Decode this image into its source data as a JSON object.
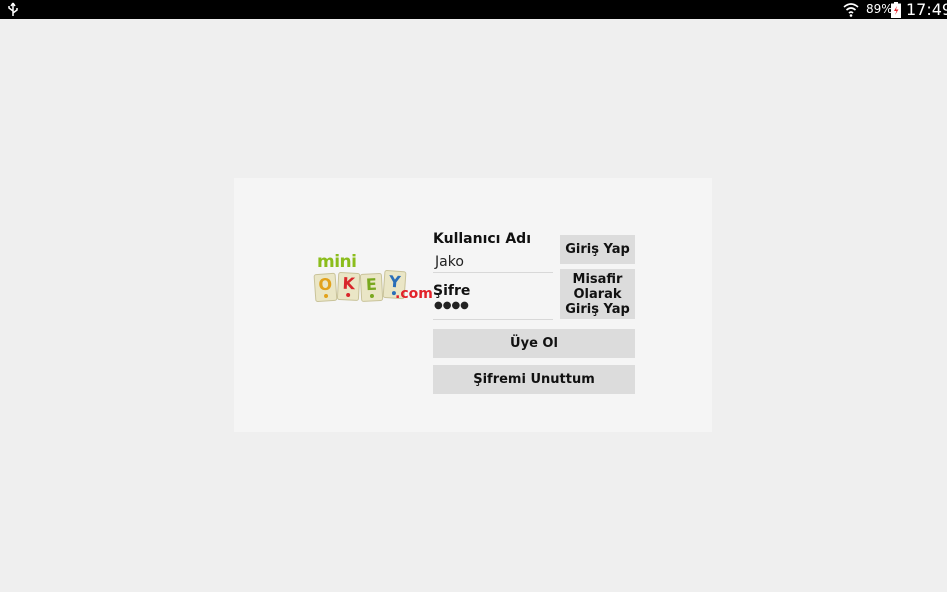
{
  "status_bar": {
    "battery_percent": "89%",
    "time": "17:49",
    "icons": [
      "usb-icon",
      "wifi-icon",
      "battery-icon"
    ]
  },
  "logo": {
    "mini": "mini",
    "tiles": [
      "O",
      "K",
      "E",
      "Y"
    ],
    "com": ".com"
  },
  "form": {
    "username_label": "Kullanıcı Adı",
    "username_value": "Jako",
    "password_label": "Şifre",
    "password_value": "●●●●"
  },
  "buttons": {
    "login": "Giriş Yap",
    "guest_login": "Misafir Olarak Giriş Yap",
    "register": "Üye Ol",
    "forgot_password": "Şifremi Unuttum"
  }
}
